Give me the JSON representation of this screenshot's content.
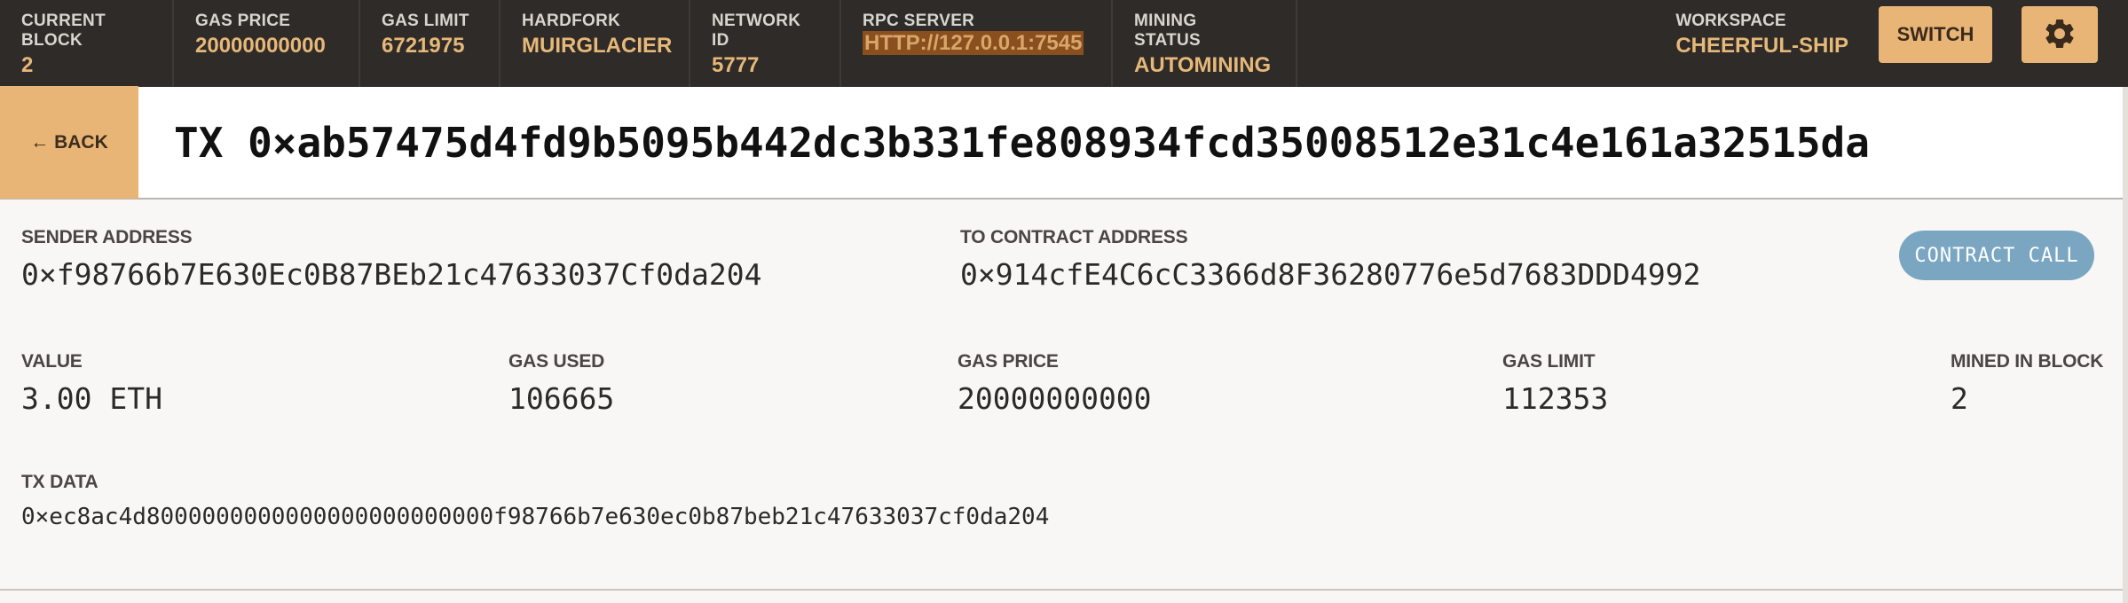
{
  "topbar": {
    "stats": [
      {
        "label": "CURRENT BLOCK",
        "value": "2"
      },
      {
        "label": "GAS PRICE",
        "value": "20000000000"
      },
      {
        "label": "GAS LIMIT",
        "value": "6721975"
      },
      {
        "label": "HARDFORK",
        "value": "MUIRGLACIER"
      },
      {
        "label": "NETWORK ID",
        "value": "5777"
      },
      {
        "label": "RPC SERVER",
        "value": "HTTP://127.0.0.1:7545"
      },
      {
        "label": "MINING STATUS",
        "value": "AUTOMINING"
      }
    ],
    "workspace_label": "WORKSPACE",
    "workspace_value": "CHEERFUL-SHIP",
    "switch_label": "SWITCH",
    "settings_icon": "gear-icon"
  },
  "header": {
    "back_label": "← BACK",
    "title": "TX 0×ab57475d4fd9b5095b442dc3b331fe808934fcd35008512e31c4e161a32515da"
  },
  "details": {
    "sender_label": "SENDER ADDRESS",
    "sender_value": "0×f98766b7E630Ec0B87BEb21c47633037Cf0da204",
    "to_label": "TO CONTRACT ADDRESS",
    "to_value": "0×914cfE4C6cC3366d8F36280776e5d7683DDD4992",
    "badge": "CONTRACT CALL",
    "value_label": "VALUE",
    "value_value": "3.00 ETH",
    "gas_used_label": "GAS USED",
    "gas_used_value": "106665",
    "gas_price_label": "GAS PRICE",
    "gas_price_value": "20000000000",
    "gas_limit_label": "GAS LIMIT",
    "gas_limit_value": "112353",
    "mined_label": "MINED IN BLOCK",
    "mined_value": "2",
    "tx_data_label": "TX DATA",
    "tx_data_value": "0×ec8ac4d8000000000000000000000000f98766b7e630ec0b87beb21c47633037cf0da204"
  },
  "colors": {
    "topbar_bg": "#2f2b28",
    "accent": "#e8b577",
    "badge": "#7ba6c2"
  }
}
